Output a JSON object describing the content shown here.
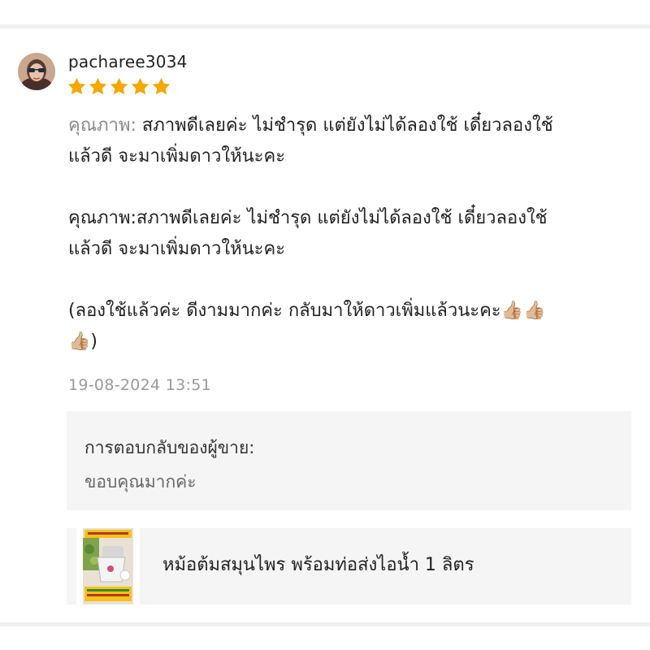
{
  "review": {
    "username": "pacharee3034",
    "rating": 5,
    "rating_max": 5,
    "star_color": "#f6a700",
    "line1_label": "คุณภาพ:",
    "line1_text": " สภาพดีเลยค่ะ ไม่ชำรุด แต่ยังไม่ได้ลองใช้ เดี๋ยวลองใช้",
    "line2_text": "แล้วดี จะมาเพิ่มดาวให้นะคะ",
    "line3_text": "คุณภาพ:สภาพดีเลยค่ะ ไม่ชำรุด แต่ยังไม่ได้ลองใช้ เดี๋ยวลองใช้",
    "line4_text": "แล้วดี จะมาเพิ่มดาวให้นะคะ",
    "line5_text": "(ลองใช้แล้วค่ะ ดีงามมากค่ะ กลับมาให้ดาวเพิ่มแล้วนะคะ",
    "line6_text": ")",
    "thumb_emoji": "👍🏼",
    "timestamp": "19-08-2024 13:51"
  },
  "seller_reply": {
    "title": "การตอบกลับของผู้ขาย:",
    "text": "ขอบคุณมากค่ะ"
  },
  "product": {
    "name": "หม้อต้มสมุนไพร พร้อมท่อส่งไอน้ำ 1 ลิตร"
  }
}
